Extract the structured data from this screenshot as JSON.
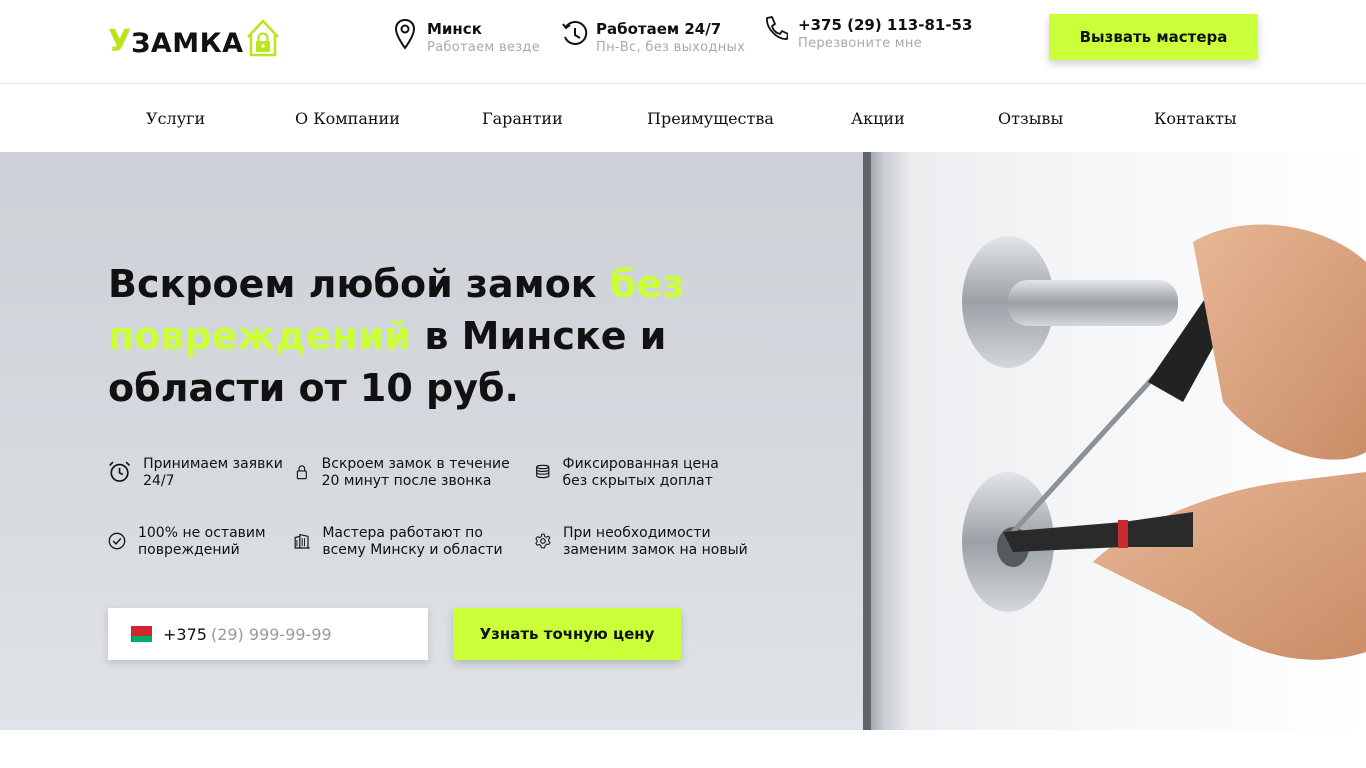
{
  "header": {
    "logo": {
      "letter": "У",
      "rest": "ЗАМКА"
    },
    "location": {
      "title": "Минск",
      "subtitle": "Работаем везде",
      "icon": "map-pin-icon"
    },
    "hours": {
      "title": "Работаем 24/7",
      "subtitle": "Пн-Вс, без выходных",
      "icon": "clock-history-icon"
    },
    "phone": {
      "title": "+375 (29) 113-81-53",
      "subtitle": "Перезвоните мне",
      "icon": "phone-icon"
    },
    "call_button": "Вызвать мастера"
  },
  "nav": {
    "items": [
      {
        "label": "Услуги"
      },
      {
        "label": "О Компании"
      },
      {
        "label": "Гарантии"
      },
      {
        "label": "Преимущества"
      },
      {
        "label": "Акции"
      },
      {
        "label": "Отзывы"
      },
      {
        "label": "Контакты"
      }
    ]
  },
  "hero": {
    "title_part1": "Вскроем любой замок ",
    "title_highlight": "без повреждений",
    "title_part2": " в Минске и области от 10 руб.",
    "features": [
      {
        "text": "Принимаем заявки 24/7",
        "icon": "alarm-clock-icon"
      },
      {
        "text": "Вскроем замок в течение 20 минут после звонка",
        "icon": "padlock-icon"
      },
      {
        "text": "Фиксированная цена без скрытых доплат",
        "icon": "coins-stack-icon"
      },
      {
        "text": "100% не оставим повреждений",
        "icon": "check-circle-icon"
      },
      {
        "text": "Мастера работают по всему Минску и области",
        "icon": "city-building-icon"
      },
      {
        "text": "При необходимости заменим замок на новый",
        "icon": "gear-icon"
      }
    ],
    "form": {
      "country_code": "+375",
      "phone_placeholder": "(29) 999-99-99",
      "submit_label": "Узнать точную цену"
    }
  },
  "colors": {
    "accent": "#cbff39",
    "logo_green": "#b7e61a",
    "text": "#111111",
    "muted": "#a9a9a9"
  }
}
